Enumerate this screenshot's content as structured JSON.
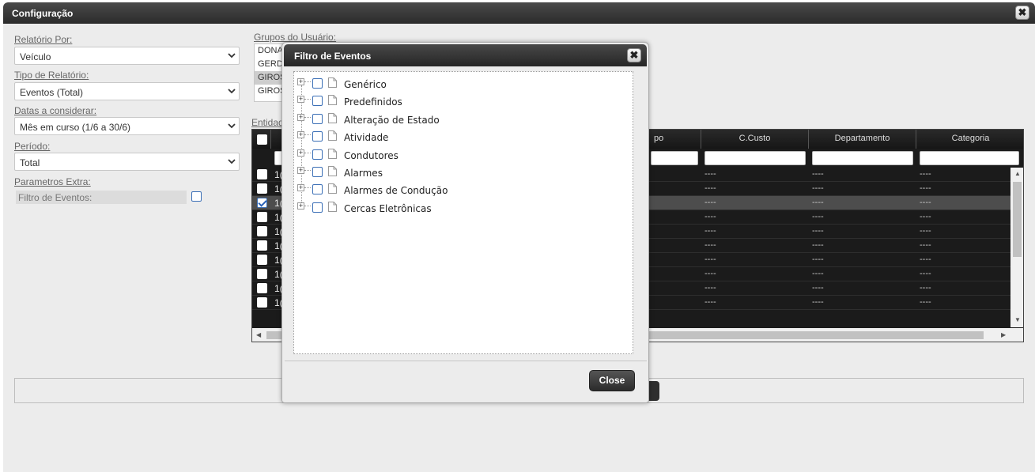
{
  "window": {
    "title": "Configuração"
  },
  "form": {
    "relatorio_por": {
      "label": "Relatório Por:",
      "value": "Veículo"
    },
    "tipo_relatorio": {
      "label": "Tipo de Relatório:",
      "value": "Eventos (Total)"
    },
    "datas": {
      "label": "Datas a considerar:",
      "value": "Mês em curso (1/6 a 30/6)"
    },
    "periodo": {
      "label": "Período:",
      "value": "Total"
    },
    "parametros": {
      "label": "Parametros Extra:",
      "filtro_label": "Filtro de Eventos:"
    }
  },
  "groups": {
    "label": "Grupos do Usuário:",
    "items": [
      "DONA",
      "GERD",
      "GIROS",
      "GIROS"
    ]
  },
  "entities": {
    "label": "Entidad",
    "columns": [
      "po",
      "C.Custo",
      "Departamento",
      "Categoria"
    ],
    "row_prefix": "1(",
    "placeholder": "----",
    "rows": [
      {
        "checked": false,
        "selected": false
      },
      {
        "checked": false,
        "selected": false
      },
      {
        "checked": true,
        "selected": true
      },
      {
        "checked": false,
        "selected": false
      },
      {
        "checked": false,
        "selected": false
      },
      {
        "checked": false,
        "selected": false
      },
      {
        "checked": false,
        "selected": false
      },
      {
        "checked": false,
        "selected": false
      },
      {
        "checked": false,
        "selected": false
      },
      {
        "checked": false,
        "selected": false
      }
    ]
  },
  "dialog": {
    "title": "Filtro de Eventos",
    "close_label": "Close",
    "tree": [
      "Genérico",
      "Predefinidos",
      "Alteração de Estado",
      "Atividade",
      "Condutores",
      "Alarmes",
      "Alarmes de Condução",
      "Cercas Eletrônicas"
    ]
  },
  "colors": {
    "titlebar": "#2b2b2b",
    "grid_bg": "#1b1b1b",
    "selected_row": "#4d4d4d",
    "checkbox_border": "#3b6fb6"
  }
}
